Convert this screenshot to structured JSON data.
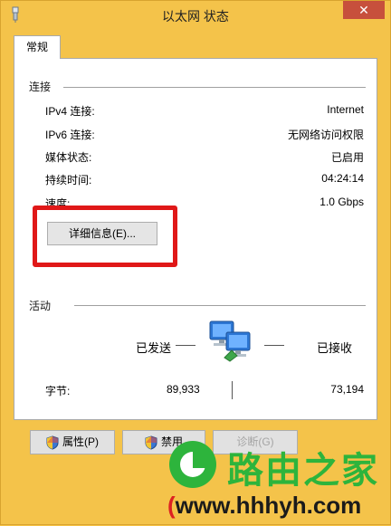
{
  "window": {
    "title": "以太网 状态",
    "close_label": "✕"
  },
  "tabs": [
    {
      "label": "常规"
    }
  ],
  "connection": {
    "heading": "连接",
    "rows": [
      {
        "label": "IPv4 连接:",
        "value": "Internet"
      },
      {
        "label": "IPv6 连接:",
        "value": "无网络访问权限"
      },
      {
        "label": "媒体状态:",
        "value": "已启用"
      },
      {
        "label": "持续时间:",
        "value": "04:24:14"
      },
      {
        "label": "速度:",
        "value": "1.0 Gbps"
      }
    ],
    "details_button": "详细信息(E)..."
  },
  "activity": {
    "heading": "活动",
    "sent_label": "已发送",
    "received_label": "已接收",
    "bytes_label": "字节:",
    "bytes_sent": "89,933",
    "bytes_received": "73,194"
  },
  "buttons": {
    "properties": "属性(P)",
    "disable": "禁用",
    "diagnose": "诊断(G)"
  },
  "watermark": {
    "title": "路由之家",
    "url_open": "(",
    "url": "www.hhhyh.com"
  },
  "colors": {
    "frame": "#f4c34a",
    "close_button": "#c7503c",
    "highlight_box": "#e01818",
    "watermark_green": "#2db43c"
  }
}
